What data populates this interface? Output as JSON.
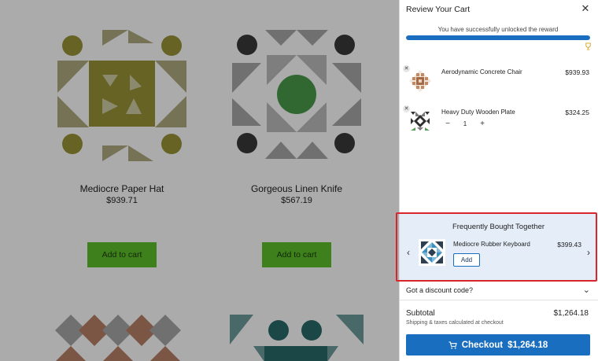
{
  "store": {
    "products": [
      {
        "name": "Mediocre Paper Hat",
        "price": "$939.71",
        "button": "Add to cart"
      },
      {
        "name": "Gorgeous Linen Knife",
        "price": "$567.19",
        "button": "Add to cart"
      }
    ]
  },
  "drawer": {
    "title": "Review Your Cart",
    "reward_text": "You have successfully unlocked the reward",
    "reward_progress_percent": 100,
    "items": [
      {
        "name": "Aerodynamic Concrete Chair",
        "price": "$939.93"
      },
      {
        "name": "Heavy Duty Wooden Plate",
        "price": "$324.25",
        "quantity": "1"
      }
    ],
    "fbt": {
      "title": "Frequently Bought Together",
      "product_name": "Mediocre Rubber Keyboard",
      "product_price": "$399.43",
      "add_label": "Add"
    },
    "discount_label": "Got a discount code?",
    "subtotal_label": "Subtotal",
    "subtotal_value": "$1,264.18",
    "shipping_note": "Shipping & taxes calculated at checkout",
    "checkout_label": "Checkout",
    "checkout_amount": "$1,264.18"
  },
  "colors": {
    "accent": "#1a6ec0",
    "add_to_cart_green": "#5cbf2a",
    "highlight_red": "#d8262c",
    "fbt_background": "#e5eef8"
  },
  "icons": [
    "close-icon",
    "trophy-icon",
    "remove-icon",
    "minus-icon",
    "plus-icon",
    "chevron-left-icon",
    "chevron-right-icon",
    "chevron-down-icon",
    "cart-icon"
  ]
}
